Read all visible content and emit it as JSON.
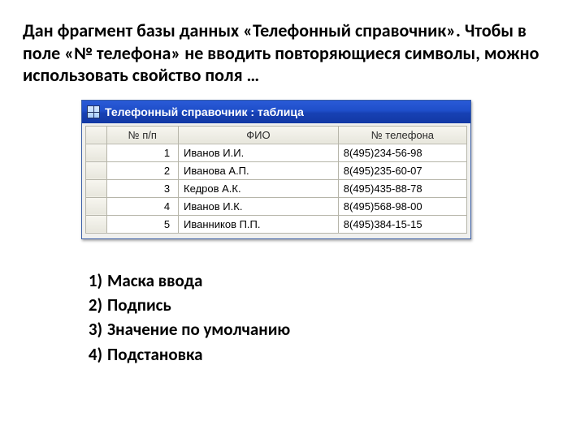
{
  "question": "Дан фрагмент базы данных «Телефонный справочник». Чтобы в поле «№ телефона» не вводить повторяющиеся символы, можно использовать свойство поля …",
  "window": {
    "title": "Телефонный справочник : таблица"
  },
  "table": {
    "headers": {
      "num": "№ п/п",
      "fio": "ФИО",
      "phone": "№ телефона"
    },
    "rows": [
      {
        "num": "1",
        "fio": "Иванов И.И.",
        "phone": "8(495)234-56-98"
      },
      {
        "num": "2",
        "fio": "Иванова А.П.",
        "phone": "8(495)235-60-07"
      },
      {
        "num": "3",
        "fio": "Кедров А.К.",
        "phone": "8(495)435-88-78"
      },
      {
        "num": "4",
        "fio": "Иванов И.К.",
        "phone": "8(495)568-98-00"
      },
      {
        "num": "5",
        "fio": "Иванников П.П.",
        "phone": "8(495)384-15-15"
      }
    ]
  },
  "answers": [
    {
      "n": "1)",
      "text": "Маска ввода"
    },
    {
      "n": "2)",
      "text": "Подпись"
    },
    {
      "n": "3)",
      "text": "Значение по умолчанию"
    },
    {
      "n": "4)",
      "text": "Подстановка"
    }
  ]
}
